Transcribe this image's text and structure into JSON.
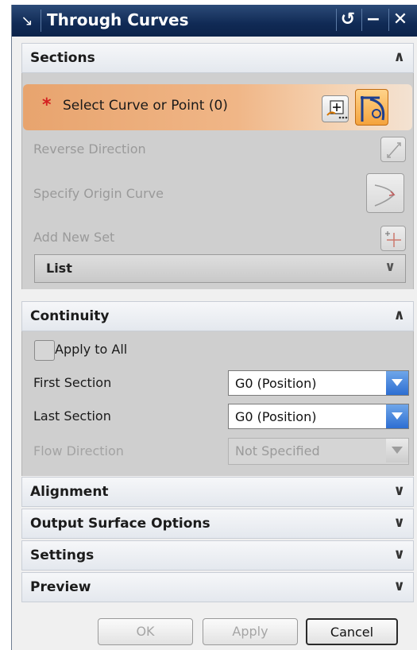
{
  "window": {
    "title": "Through Curves",
    "icons": [
      "pointer-icon",
      "reset-icon",
      "minimize-icon",
      "close-icon"
    ]
  },
  "sections": {
    "header": "Sections",
    "select_label": "Select Curve or Point (0)",
    "reverse_direction": "Reverse Direction",
    "specify_origin": "Specify Origin Curve",
    "add_new_set": "Add New Set",
    "list_label": "List"
  },
  "continuity": {
    "header": "Continuity",
    "apply_to_all": "Apply to All",
    "first_section_label": "First Section",
    "first_section_value": "G0 (Position)",
    "last_section_label": "Last Section",
    "last_section_value": "G0 (Position)",
    "flow_direction_label": "Flow Direction",
    "flow_direction_value": "Not Specified"
  },
  "collapsed_groups": [
    "Alignment",
    "Output Surface Options",
    "Settings",
    "Preview"
  ],
  "buttons": {
    "ok": "OK",
    "apply": "Apply",
    "cancel": "Cancel"
  },
  "colors": {
    "titlebar": "#102a55",
    "select_highlight": "#f0b687",
    "dropdown_accent": "#2d6ed2"
  }
}
